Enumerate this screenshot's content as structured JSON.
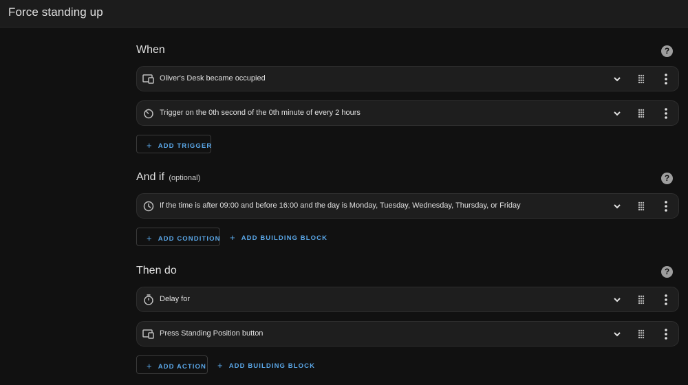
{
  "page": {
    "title": "Force standing up"
  },
  "sections": {
    "when": {
      "title": "When",
      "rows": [
        {
          "label": "Oliver's Desk became occupied",
          "icon": "device-icon"
        },
        {
          "label": "Trigger on the 0th second of the 0th minute of every 2 hours",
          "icon": "timer-icon"
        }
      ],
      "add_trigger": "ADD TRIGGER"
    },
    "and_if": {
      "title": "And if",
      "optional": "(optional)",
      "rows": [
        {
          "label": "If the time is after 09:00 and before 16:00 and the day is Monday, Tuesday, Wednesday, Thursday, or Friday",
          "icon": "clock-icon"
        }
      ],
      "add_condition": "ADD CONDITION",
      "add_building_block": "ADD BUILDING BLOCK"
    },
    "then_do": {
      "title": "Then do",
      "rows": [
        {
          "label": "Delay for",
          "icon": "stopwatch-icon"
        },
        {
          "label": "Press Standing Position button",
          "icon": "device-icon"
        }
      ],
      "add_action": "ADD ACTION",
      "add_building_block": "ADD BUILDING BLOCK"
    }
  },
  "colors": {
    "accent": "#5aa7e8",
    "background": "#111111",
    "card": "#1e1e1e"
  }
}
